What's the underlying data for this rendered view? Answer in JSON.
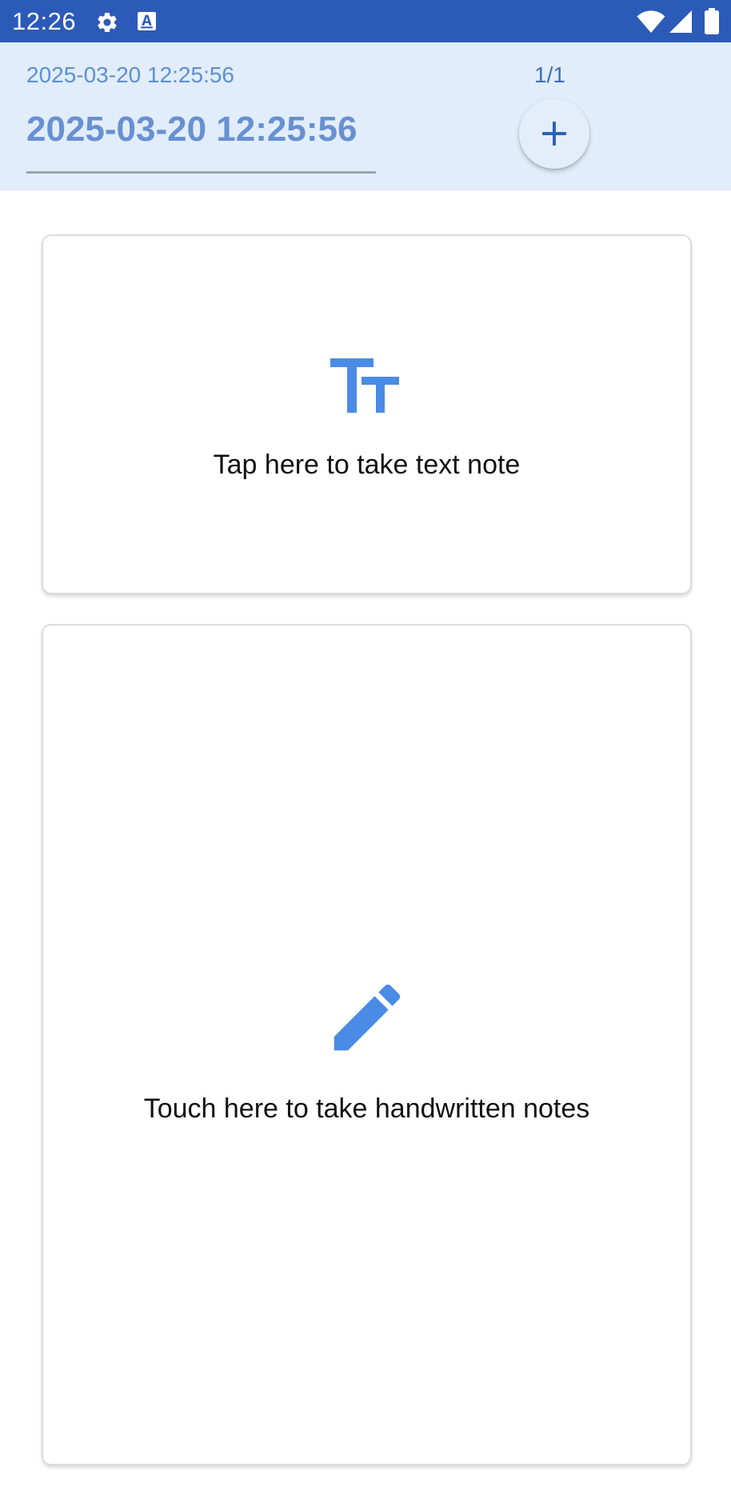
{
  "status_bar": {
    "time": "12:26",
    "icons": [
      "gear-icon",
      "text-a-icon",
      "wifi-icon",
      "signal-icon",
      "battery-icon"
    ]
  },
  "header": {
    "subtitle": "2025-03-20 12:25:56",
    "page_indicator": "1/1",
    "title_value": "2025-03-20 12:25:56",
    "add_icon": "plus-icon"
  },
  "cards": {
    "text_note": {
      "icon": "text-size-icon",
      "label": "Tap here to take text note"
    },
    "handwritten_note": {
      "icon": "pencil-icon",
      "label": "Touch here to take handwritten notes"
    }
  },
  "colors": {
    "status_bar": "#2b5ab8",
    "header_bg": "#e1edfa",
    "accent": "#4a8be6",
    "title_text": "#6890d2"
  }
}
